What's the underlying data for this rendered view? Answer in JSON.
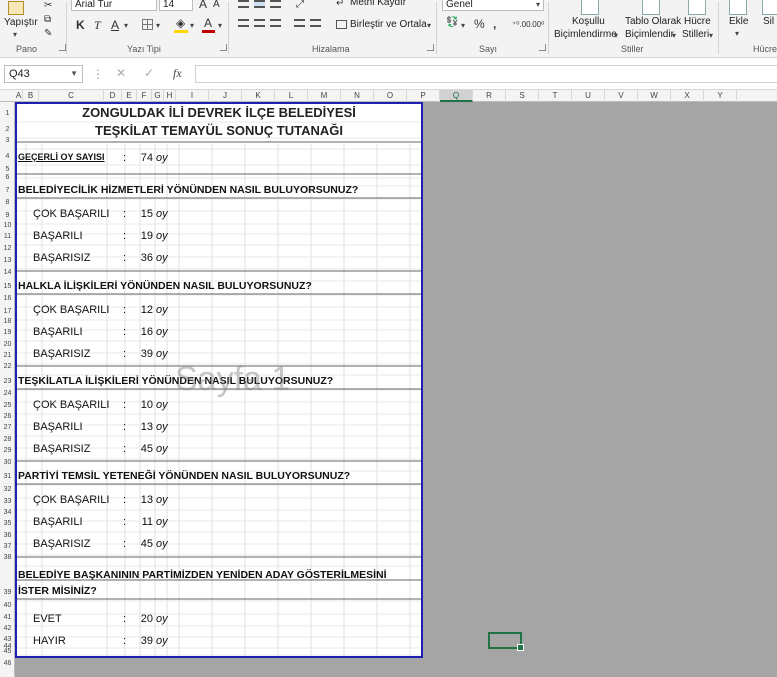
{
  "ribbon": {
    "clipboard": {
      "paste": "Yapıştır",
      "group": "Pano"
    },
    "font": {
      "name": "Arial Tur",
      "size": "14",
      "bold": "K",
      "italic": "T",
      "underline": "A",
      "grow": "A",
      "shrink": "A",
      "group": "Yazı Tipi"
    },
    "alignment": {
      "wrap": "Metni Kaydır",
      "merge": "Birleştir ve Ortala",
      "group": "Hizalama"
    },
    "number": {
      "format": "Genel",
      "percent": "%",
      "group": "Sayı"
    },
    "styles": {
      "conditional_1": "Koşullu",
      "conditional_2": "Biçimlendirme",
      "table_1": "Tablo Olarak",
      "table_2": "Biçimlendir",
      "cell_1": "Hücre",
      "cell_2": "Stilleri",
      "group": "Stiller"
    },
    "cells": {
      "insert": "Ekle",
      "delete": "Sil",
      "group": "Hücre"
    }
  },
  "formula_bar": {
    "name_box": "Q43",
    "fx": "fx",
    "cancel": "✕",
    "confirm": "✓"
  },
  "columns": [
    "A",
    "B",
    "C",
    "D",
    "E",
    "F",
    "G",
    "H",
    "I",
    "J",
    "K",
    "L",
    "M",
    "N",
    "O",
    "P",
    "Q",
    "R",
    "S",
    "T",
    "U",
    "V",
    "W",
    "X",
    "Y"
  ],
  "selected_column": "Q",
  "rows": [
    "1",
    "2",
    "3",
    "4",
    "5",
    "6",
    "7",
    "8",
    "9",
    "10",
    "11",
    "12",
    "13",
    "14",
    "15",
    "16",
    "17",
    "18",
    "19",
    "20",
    "21",
    "22",
    "23",
    "24",
    "25",
    "26",
    "27",
    "28",
    "29",
    "30",
    "31",
    "32",
    "33",
    "34",
    "35",
    "36",
    "37",
    "38",
    "39",
    "40",
    "41",
    "42",
    "43",
    "44",
    "45",
    "46"
  ],
  "watermark": "Sayfa 1",
  "sheet": {
    "title_1": "ZONGULDAK İLİ DEVREK İLÇE BELEDİYESİ",
    "title_2": "TEŞKİLAT TEMAYÜL SONUÇ TUTANAĞI",
    "valid_votes": {
      "label": "GEÇERLİ OY SAYISI",
      "colon": ":",
      "value": "74",
      "unit": "oy"
    },
    "sections": [
      {
        "question": "BELEDİYECİLİK HİZMETLERİ YÖNÜNDEN NASIL BULUYORSUNUZ?",
        "options": [
          {
            "label": "ÇOK BAŞARILI",
            "value": "15",
            "unit": "oy"
          },
          {
            "label": "BAŞARILI",
            "value": "19",
            "unit": "oy"
          },
          {
            "label": "BAŞARISIZ",
            "value": "36",
            "unit": "oy"
          }
        ]
      },
      {
        "question": "HALKLA İLİŞKİLERİ YÖNÜNDEN NASIL BULUYORSUNUZ?",
        "options": [
          {
            "label": "ÇOK BAŞARILI",
            "value": "12",
            "unit": "oy"
          },
          {
            "label": "BAŞARILI",
            "value": "16",
            "unit": "oy"
          },
          {
            "label": "BAŞARISIZ",
            "value": "39",
            "unit": "oy"
          }
        ]
      },
      {
        "question": "TEŞKİLATLA İLİŞKİLERİ YÖNÜNDEN NASIL BULUYORSUNUZ?",
        "options": [
          {
            "label": "ÇOK BAŞARILI",
            "value": "10",
            "unit": "oy"
          },
          {
            "label": "BAŞARILI",
            "value": "13",
            "unit": "oy"
          },
          {
            "label": "BAŞARISIZ",
            "value": "45",
            "unit": "oy"
          }
        ]
      },
      {
        "question": "PARTİYİ TEMSİL YETENEĞİ YÖNÜNDEN NASIL BULUYORSUNUZ?",
        "options": [
          {
            "label": "ÇOK BAŞARILI",
            "value": "13",
            "unit": "oy"
          },
          {
            "label": "BAŞARILI",
            "value": "11",
            "unit": "oy"
          },
          {
            "label": "BAŞARISIZ",
            "value": "45",
            "unit": "oy"
          }
        ]
      }
    ],
    "final": {
      "question_1": "BELEDİYE BAŞKANININ PARTİMİZDEN YENİDEN ADAY GÖSTERİLMESİNİ",
      "question_2": "İSTER MİSİNİZ?",
      "options": [
        {
          "label": "EVET",
          "value": "20",
          "unit": "oy"
        },
        {
          "label": "HAYIR",
          "value": "39",
          "unit": "oy"
        }
      ]
    }
  }
}
